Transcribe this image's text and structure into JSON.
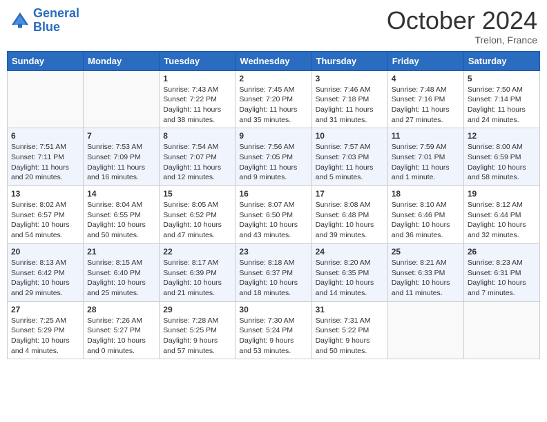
{
  "header": {
    "logo_line1": "General",
    "logo_line2": "Blue",
    "month": "October 2024",
    "location": "Trelon, France"
  },
  "weekdays": [
    "Sunday",
    "Monday",
    "Tuesday",
    "Wednesday",
    "Thursday",
    "Friday",
    "Saturday"
  ],
  "weeks": [
    [
      {
        "day": "",
        "sunrise": "",
        "sunset": "",
        "daylight": ""
      },
      {
        "day": "",
        "sunrise": "",
        "sunset": "",
        "daylight": ""
      },
      {
        "day": "1",
        "sunrise": "Sunrise: 7:43 AM",
        "sunset": "Sunset: 7:22 PM",
        "daylight": "Daylight: 11 hours and 38 minutes."
      },
      {
        "day": "2",
        "sunrise": "Sunrise: 7:45 AM",
        "sunset": "Sunset: 7:20 PM",
        "daylight": "Daylight: 11 hours and 35 minutes."
      },
      {
        "day": "3",
        "sunrise": "Sunrise: 7:46 AM",
        "sunset": "Sunset: 7:18 PM",
        "daylight": "Daylight: 11 hours and 31 minutes."
      },
      {
        "day": "4",
        "sunrise": "Sunrise: 7:48 AM",
        "sunset": "Sunset: 7:16 PM",
        "daylight": "Daylight: 11 hours and 27 minutes."
      },
      {
        "day": "5",
        "sunrise": "Sunrise: 7:50 AM",
        "sunset": "Sunset: 7:14 PM",
        "daylight": "Daylight: 11 hours and 24 minutes."
      }
    ],
    [
      {
        "day": "6",
        "sunrise": "Sunrise: 7:51 AM",
        "sunset": "Sunset: 7:11 PM",
        "daylight": "Daylight: 11 hours and 20 minutes."
      },
      {
        "day": "7",
        "sunrise": "Sunrise: 7:53 AM",
        "sunset": "Sunset: 7:09 PM",
        "daylight": "Daylight: 11 hours and 16 minutes."
      },
      {
        "day": "8",
        "sunrise": "Sunrise: 7:54 AM",
        "sunset": "Sunset: 7:07 PM",
        "daylight": "Daylight: 11 hours and 12 minutes."
      },
      {
        "day": "9",
        "sunrise": "Sunrise: 7:56 AM",
        "sunset": "Sunset: 7:05 PM",
        "daylight": "Daylight: 11 hours and 9 minutes."
      },
      {
        "day": "10",
        "sunrise": "Sunrise: 7:57 AM",
        "sunset": "Sunset: 7:03 PM",
        "daylight": "Daylight: 11 hours and 5 minutes."
      },
      {
        "day": "11",
        "sunrise": "Sunrise: 7:59 AM",
        "sunset": "Sunset: 7:01 PM",
        "daylight": "Daylight: 11 hours and 1 minute."
      },
      {
        "day": "12",
        "sunrise": "Sunrise: 8:00 AM",
        "sunset": "Sunset: 6:59 PM",
        "daylight": "Daylight: 10 hours and 58 minutes."
      }
    ],
    [
      {
        "day": "13",
        "sunrise": "Sunrise: 8:02 AM",
        "sunset": "Sunset: 6:57 PM",
        "daylight": "Daylight: 10 hours and 54 minutes."
      },
      {
        "day": "14",
        "sunrise": "Sunrise: 8:04 AM",
        "sunset": "Sunset: 6:55 PM",
        "daylight": "Daylight: 10 hours and 50 minutes."
      },
      {
        "day": "15",
        "sunrise": "Sunrise: 8:05 AM",
        "sunset": "Sunset: 6:52 PM",
        "daylight": "Daylight: 10 hours and 47 minutes."
      },
      {
        "day": "16",
        "sunrise": "Sunrise: 8:07 AM",
        "sunset": "Sunset: 6:50 PM",
        "daylight": "Daylight: 10 hours and 43 minutes."
      },
      {
        "day": "17",
        "sunrise": "Sunrise: 8:08 AM",
        "sunset": "Sunset: 6:48 PM",
        "daylight": "Daylight: 10 hours and 39 minutes."
      },
      {
        "day": "18",
        "sunrise": "Sunrise: 8:10 AM",
        "sunset": "Sunset: 6:46 PM",
        "daylight": "Daylight: 10 hours and 36 minutes."
      },
      {
        "day": "19",
        "sunrise": "Sunrise: 8:12 AM",
        "sunset": "Sunset: 6:44 PM",
        "daylight": "Daylight: 10 hours and 32 minutes."
      }
    ],
    [
      {
        "day": "20",
        "sunrise": "Sunrise: 8:13 AM",
        "sunset": "Sunset: 6:42 PM",
        "daylight": "Daylight: 10 hours and 29 minutes."
      },
      {
        "day": "21",
        "sunrise": "Sunrise: 8:15 AM",
        "sunset": "Sunset: 6:40 PM",
        "daylight": "Daylight: 10 hours and 25 minutes."
      },
      {
        "day": "22",
        "sunrise": "Sunrise: 8:17 AM",
        "sunset": "Sunset: 6:39 PM",
        "daylight": "Daylight: 10 hours and 21 minutes."
      },
      {
        "day": "23",
        "sunrise": "Sunrise: 8:18 AM",
        "sunset": "Sunset: 6:37 PM",
        "daylight": "Daylight: 10 hours and 18 minutes."
      },
      {
        "day": "24",
        "sunrise": "Sunrise: 8:20 AM",
        "sunset": "Sunset: 6:35 PM",
        "daylight": "Daylight: 10 hours and 14 minutes."
      },
      {
        "day": "25",
        "sunrise": "Sunrise: 8:21 AM",
        "sunset": "Sunset: 6:33 PM",
        "daylight": "Daylight: 10 hours and 11 minutes."
      },
      {
        "day": "26",
        "sunrise": "Sunrise: 8:23 AM",
        "sunset": "Sunset: 6:31 PM",
        "daylight": "Daylight: 10 hours and 7 minutes."
      }
    ],
    [
      {
        "day": "27",
        "sunrise": "Sunrise: 7:25 AM",
        "sunset": "Sunset: 5:29 PM",
        "daylight": "Daylight: 10 hours and 4 minutes."
      },
      {
        "day": "28",
        "sunrise": "Sunrise: 7:26 AM",
        "sunset": "Sunset: 5:27 PM",
        "daylight": "Daylight: 10 hours and 0 minutes."
      },
      {
        "day": "29",
        "sunrise": "Sunrise: 7:28 AM",
        "sunset": "Sunset: 5:25 PM",
        "daylight": "Daylight: 9 hours and 57 minutes."
      },
      {
        "day": "30",
        "sunrise": "Sunrise: 7:30 AM",
        "sunset": "Sunset: 5:24 PM",
        "daylight": "Daylight: 9 hours and 53 minutes."
      },
      {
        "day": "31",
        "sunrise": "Sunrise: 7:31 AM",
        "sunset": "Sunset: 5:22 PM",
        "daylight": "Daylight: 9 hours and 50 minutes."
      },
      {
        "day": "",
        "sunrise": "",
        "sunset": "",
        "daylight": ""
      },
      {
        "day": "",
        "sunrise": "",
        "sunset": "",
        "daylight": ""
      }
    ]
  ]
}
